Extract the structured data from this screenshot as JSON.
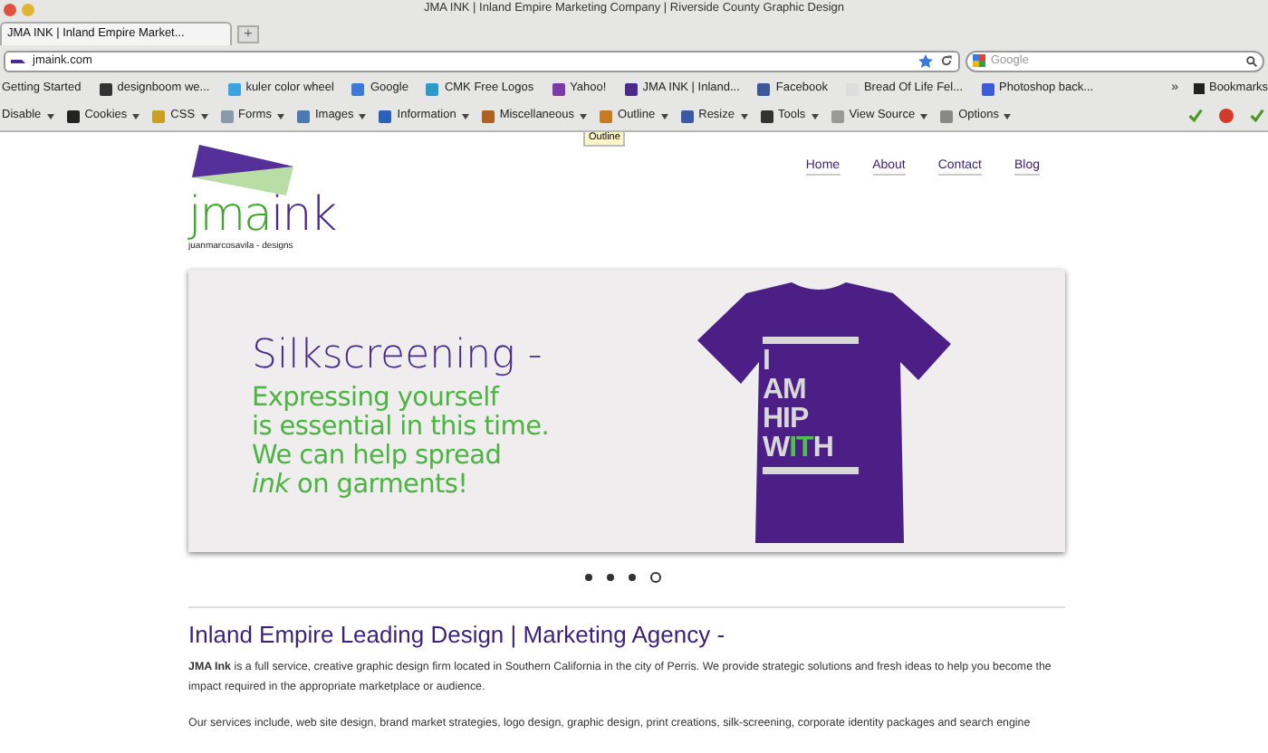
{
  "window": {
    "title": "JMA INK | Inland Empire Marketing Company | Riverside County Graphic Design"
  },
  "tabs": [
    {
      "label": "JMA INK | Inland Empire Market...",
      "selected": true
    }
  ],
  "new_tab": "+",
  "address_bar": {
    "value": "jmaink.com"
  },
  "search": {
    "placeholder": "Google"
  },
  "bookmarks": [
    {
      "label": "Getting Started"
    },
    {
      "label": "designboom we..."
    },
    {
      "label": "kuler color wheel"
    },
    {
      "label": "Google"
    },
    {
      "label": "CMK Free Logos"
    },
    {
      "label": "Yahoo!"
    },
    {
      "label": "JMA INK | Inland..."
    },
    {
      "label": "Facebook"
    },
    {
      "label": "Bread Of Life Fel..."
    },
    {
      "label": "Photoshop back..."
    }
  ],
  "bookmarks_overflow": "»",
  "bookmarks_menu": "Bookmarks",
  "toolbar": [
    {
      "label": "Disable"
    },
    {
      "label": "Cookies"
    },
    {
      "label": "CSS"
    },
    {
      "label": "Forms"
    },
    {
      "label": "Images"
    },
    {
      "label": "Information"
    },
    {
      "label": "Miscellaneous"
    },
    {
      "label": "Outline"
    },
    {
      "label": "Resize"
    },
    {
      "label": "Tools"
    },
    {
      "label": "View Source"
    },
    {
      "label": "Options"
    }
  ],
  "tooltip": "Outline",
  "logo": {
    "green": "jma",
    "purple": "ink",
    "tagline": "juanmarcosavila - designs"
  },
  "nav": [
    {
      "label": "Home"
    },
    {
      "label": "About"
    },
    {
      "label": "Contact"
    },
    {
      "label": "Blog"
    }
  ],
  "slide": {
    "heading": "Silkscreening -",
    "lines": [
      "Expressing yourself",
      "is essential in this time.",
      "We can help spread",
      "*ink* on garments!"
    ],
    "shirt_lines": [
      [
        {
          "text": "I",
          "highlight": false
        }
      ],
      [
        {
          "text": "AM",
          "highlight": false
        }
      ],
      [
        {
          "text": "HIP",
          "highlight": false
        }
      ],
      [
        {
          "text": "W",
          "highlight": false
        },
        {
          "text": "IT",
          "highlight": true
        },
        {
          "text": "H",
          "highlight": false
        }
      ]
    ]
  },
  "slider_dots": [
    {
      "selected": false
    },
    {
      "selected": false
    },
    {
      "selected": false
    },
    {
      "selected": true
    }
  ],
  "section": {
    "heading": "Inland Empire Leading Design | Marketing Agency -",
    "paragraphs": [
      "**JMA Ink** is a full service, creative graphic design firm located in Southern California in the city of Perris. We provide strategic solutions and fresh ideas to help you become the impact required in the appropriate marketplace or audience.",
      "Our services include, web site design, brand market strategies, logo design, graphic design, print creations, silk-screening, corporate identity packages and search engine"
    ]
  }
}
